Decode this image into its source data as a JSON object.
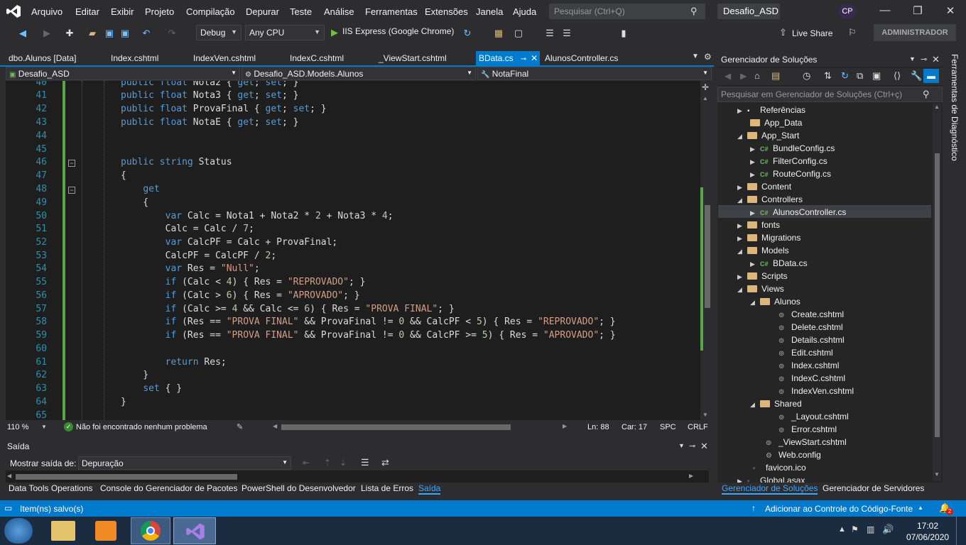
{
  "menu": {
    "items": [
      "Arquivo",
      "Editar",
      "Exibir",
      "Projeto",
      "Compilação",
      "Depurar",
      "Teste",
      "Análise",
      "Ferramentas",
      "Extensões",
      "Janela",
      "Ajuda"
    ],
    "search_placeholder": "Pesquisar (Ctrl+Q)",
    "solution_name": "Desafio_ASD",
    "user_initials": "CP"
  },
  "toolbar": {
    "config": "Debug",
    "platform": "Any CPU",
    "run_target": "IIS Express (Google Chrome)",
    "live_share": "Live Share",
    "admin": "ADMINISTRADOR"
  },
  "tabs": [
    {
      "label": "dbo.Alunos [Data]"
    },
    {
      "label": "Index.cshtml"
    },
    {
      "label": "IndexVen.cshtml"
    },
    {
      "label": "IndexC.cshtml"
    },
    {
      "label": "_ViewStart.cshtml"
    },
    {
      "label": "BData.cs"
    },
    {
      "label": "AlunosController.cs"
    }
  ],
  "navbar": {
    "project": "Desafio_ASD",
    "type": "Desafio_ASD.Models.Alunos",
    "member": "NotaFinal"
  },
  "code": {
    "line_numbers": [
      "40",
      "41",
      "42",
      "43",
      "44",
      "45",
      "46",
      "47",
      "48",
      "49",
      "50",
      "51",
      "52",
      "53",
      "54",
      "55",
      "56",
      "57",
      "58",
      "59",
      "60",
      "61",
      "62",
      "63",
      "64",
      "65"
    ]
  },
  "editor_status": {
    "zoom": "110 %",
    "problems": "Não foi encontrado nenhum problema",
    "ln": "Ln: 88",
    "car": "Car: 17",
    "spc": "SPC",
    "crlf": "CRLF"
  },
  "output": {
    "title": "Saída",
    "show_label": "Mostrar saída de:",
    "source": "Depuração"
  },
  "bottom_tabs": [
    "Data Tools Operations",
    "Console do Gerenciador de Pacotes",
    "PowerShell do Desenvolvedor",
    "Lista de Erros",
    "Saída"
  ],
  "solution_explorer": {
    "title": "Gerenciador de Soluções",
    "search_placeholder": "Pesquisar em Gerenciador de Soluções (Ctrl+ç)",
    "tree": [
      {
        "label": "Referências"
      },
      {
        "label": "App_Data"
      },
      {
        "label": "App_Start"
      },
      {
        "label": "BundleConfig.cs"
      },
      {
        "label": "FilterConfig.cs"
      },
      {
        "label": "RouteConfig.cs"
      },
      {
        "label": "Content"
      },
      {
        "label": "Controllers"
      },
      {
        "label": "AlunosController.cs"
      },
      {
        "label": "fonts"
      },
      {
        "label": "Migrations"
      },
      {
        "label": "Models"
      },
      {
        "label": "BData.cs"
      },
      {
        "label": "Scripts"
      },
      {
        "label": "Views"
      },
      {
        "label": "Alunos"
      },
      {
        "label": "Create.cshtml"
      },
      {
        "label": "Delete.cshtml"
      },
      {
        "label": "Details.cshtml"
      },
      {
        "label": "Edit.cshtml"
      },
      {
        "label": "Index.cshtml"
      },
      {
        "label": "IndexC.cshtml"
      },
      {
        "label": "IndexVen.cshtml"
      },
      {
        "label": "Shared"
      },
      {
        "label": "_Layout.cshtml"
      },
      {
        "label": "Error.cshtml"
      },
      {
        "label": "_ViewStart.cshtml"
      },
      {
        "label": "Web.config"
      },
      {
        "label": "favicon.ico"
      },
      {
        "label": "Global.asax"
      }
    ],
    "tabs": [
      "Gerenciador de Soluções",
      "Gerenciador de Servidores"
    ]
  },
  "right_strip": "Ferramentas de Diagnóstico",
  "statusbar": {
    "left": "Item(ns) salvo(s)",
    "right": "Adicionar ao Controle do Código-Fonte",
    "notifications": "2"
  },
  "taskbar": {
    "time": "17:02",
    "date": "07/06/2020"
  },
  "colors": {
    "accent": "#007acc",
    "keyword": "#569cd6",
    "string": "#d69d85",
    "linenumber": "#2b91af"
  }
}
